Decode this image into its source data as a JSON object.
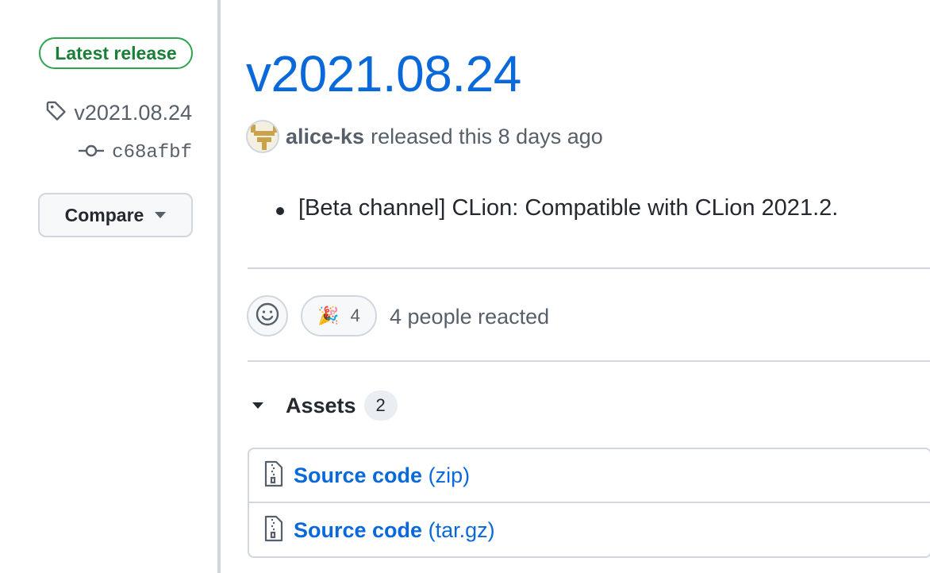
{
  "sidebar": {
    "latest_badge": "Latest release",
    "tag": "v2021.08.24",
    "commit": "c68afbf",
    "compare_label": "Compare"
  },
  "release": {
    "title": "v2021.08.24",
    "author": "alice-ks",
    "released_text": "released this 8 days ago",
    "notes": [
      "[Beta channel] CLion: Compatible with CLion 2021.2."
    ]
  },
  "reactions": {
    "emoji": "🎉",
    "count": "4",
    "summary": "4 people reacted"
  },
  "assets": {
    "label": "Assets",
    "count": "2",
    "items": [
      {
        "name": "Source code",
        "ext": "(zip)"
      },
      {
        "name": "Source code",
        "ext": "(tar.gz)"
      }
    ]
  },
  "colors": {
    "link": "#0969da",
    "success": "#1a7f37",
    "border": "#d0d7de"
  }
}
